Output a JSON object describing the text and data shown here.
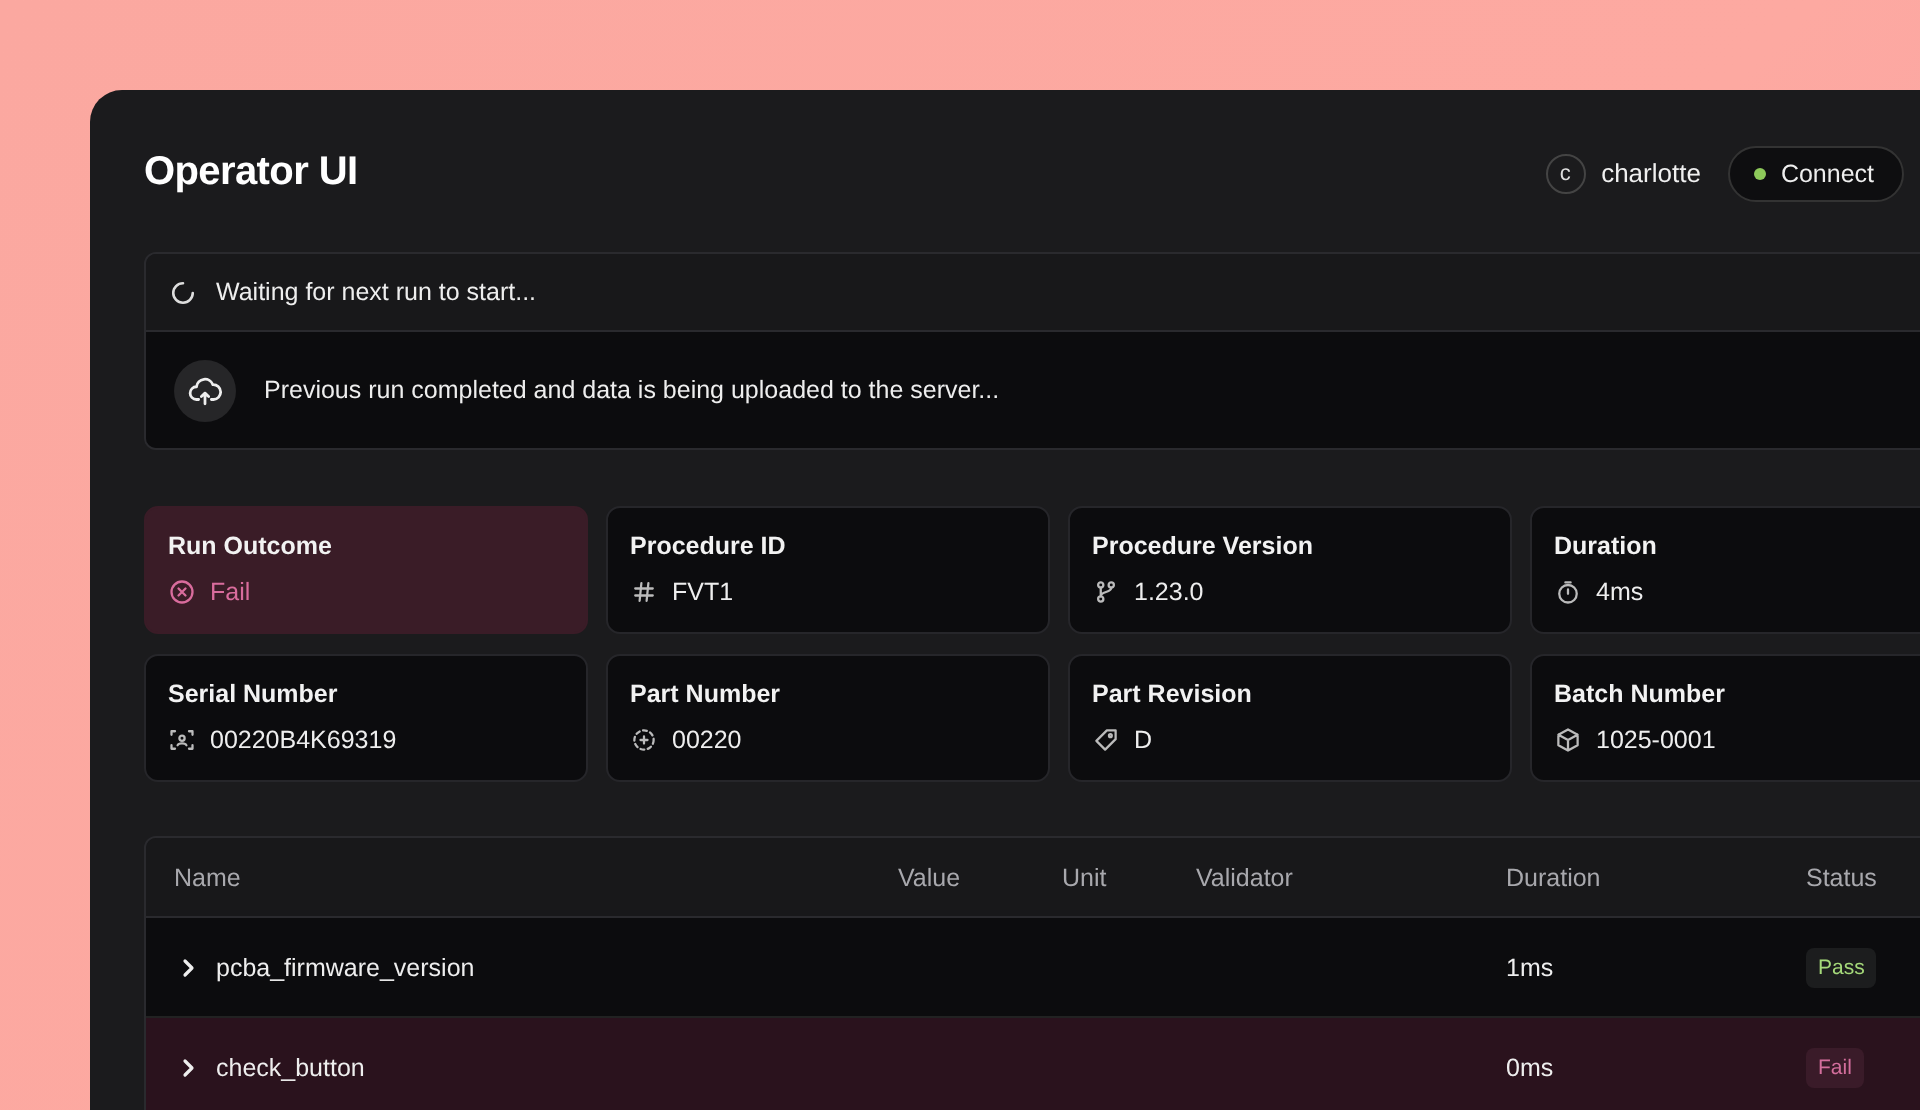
{
  "header": {
    "title": "Operator UI",
    "user": {
      "initial": "c",
      "name": "charlotte"
    },
    "connection": {
      "label": "Connect",
      "connected": true
    }
  },
  "status_panel": {
    "waiting": "Waiting for next run to start...",
    "upload": "Previous run completed and data is being uploaded to the server..."
  },
  "cards": [
    {
      "kind": "outcome",
      "label": "Run Outcome",
      "value": "Fail",
      "passed": false
    },
    {
      "kind": "procedure",
      "label": "Procedure ID",
      "value": "FVT1"
    },
    {
      "kind": "version",
      "label": "Procedure Version",
      "value": "1.23.0"
    },
    {
      "kind": "duration",
      "label": "Duration",
      "value": "4ms"
    },
    {
      "kind": "serial",
      "label": "Serial Number",
      "value": "00220B4K69319"
    },
    {
      "kind": "part",
      "label": "Part Number",
      "value": "00220"
    },
    {
      "kind": "revision",
      "label": "Part Revision",
      "value": "D"
    },
    {
      "kind": "batch",
      "label": "Batch Number",
      "value": "1025-0001"
    }
  ],
  "table": {
    "columns": [
      "Name",
      "Value",
      "Unit",
      "Validator",
      "Duration",
      "Status"
    ],
    "rows": [
      {
        "name": "pcba_firmware_version",
        "duration": "1ms",
        "status": "Pass",
        "passed": true,
        "expanded": false
      },
      {
        "name": "check_button",
        "duration": "0ms",
        "status": "Fail",
        "passed": false,
        "expanded": false
      }
    ]
  }
}
